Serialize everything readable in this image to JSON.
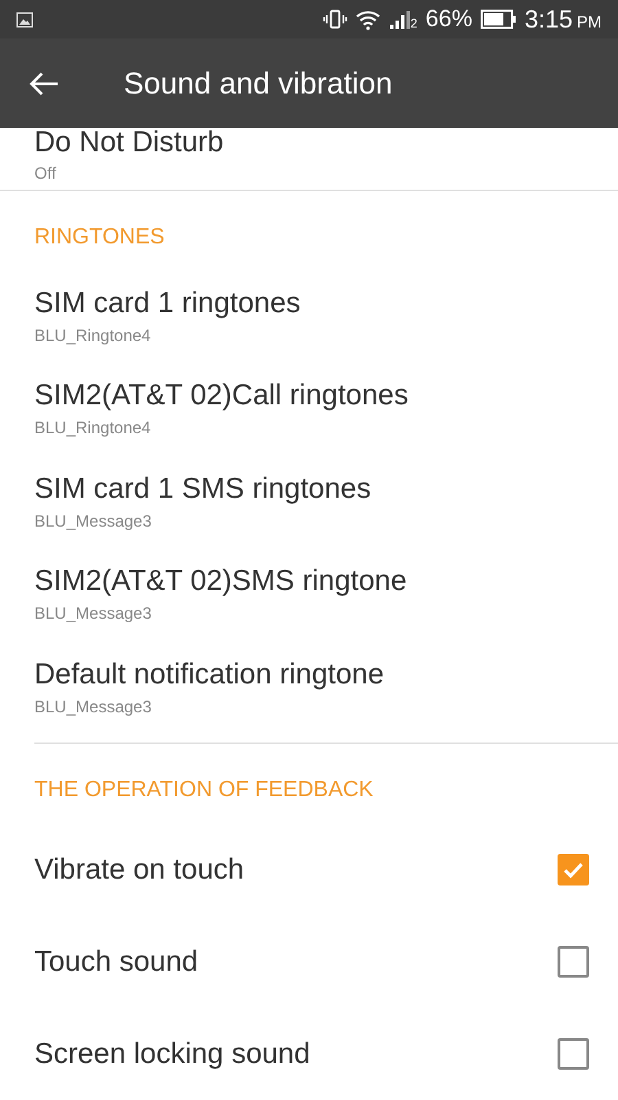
{
  "status_bar": {
    "sim_index": "2",
    "battery": "66%",
    "time": "3:15",
    "meridiem": "PM"
  },
  "app_bar": {
    "title": "Sound and vibration"
  },
  "top_item": {
    "title": "Do Not Disturb",
    "subtitle": "Off"
  },
  "sections": [
    {
      "header": "RINGTONES",
      "items": [
        {
          "kind": "value",
          "title": "SIM card 1 ringtones",
          "subtitle": "BLU_Ringtone4"
        },
        {
          "kind": "value",
          "title": "SIM2(AT&T 02)Call ringtones",
          "subtitle": "BLU_Ringtone4"
        },
        {
          "kind": "value",
          "title": "SIM card 1 SMS ringtones",
          "subtitle": "BLU_Message3"
        },
        {
          "kind": "value",
          "title": "SIM2(AT&T 02)SMS ringtone",
          "subtitle": "BLU_Message3"
        },
        {
          "kind": "value",
          "title": "Default notification ringtone",
          "subtitle": "BLU_Message3"
        }
      ]
    },
    {
      "header": "THE OPERATION OF FEEDBACK",
      "items": [
        {
          "kind": "checkbox",
          "title": "Vibrate on touch",
          "checked": true
        },
        {
          "kind": "checkbox",
          "title": "Touch sound",
          "checked": false
        },
        {
          "kind": "checkbox",
          "title": "Screen locking sound",
          "checked": false
        }
      ]
    }
  ]
}
